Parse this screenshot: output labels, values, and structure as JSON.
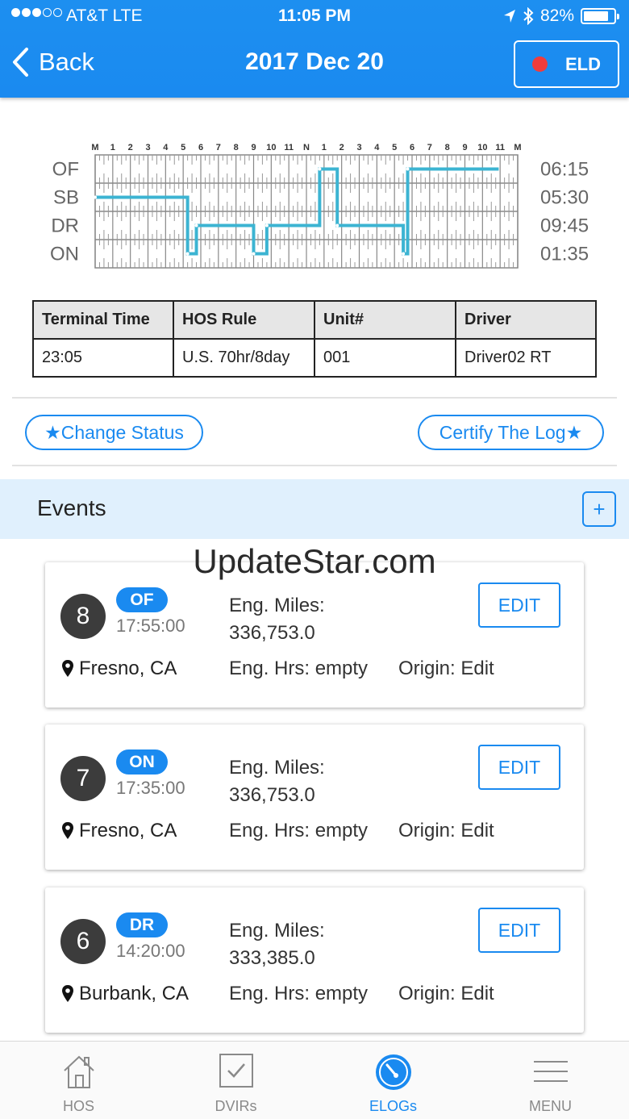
{
  "status_bar": {
    "carrier": "AT&T   LTE",
    "time": "11:05 PM",
    "battery": "82%",
    "battery_level": 0.82,
    "signal_bars_filled": 3,
    "signal_bars_total": 5
  },
  "nav": {
    "back_label": "Back",
    "title": "2017 Dec 20",
    "eld_label": "ELD"
  },
  "log_chart": {
    "hour_labels": [
      "M",
      "1",
      "2",
      "3",
      "4",
      "5",
      "6",
      "7",
      "8",
      "9",
      "10",
      "11",
      "N",
      "1",
      "2",
      "3",
      "4",
      "5",
      "6",
      "7",
      "8",
      "9",
      "10",
      "11",
      "M"
    ],
    "statuses": [
      "OF",
      "SB",
      "DR",
      "ON"
    ],
    "totals": [
      "06:15",
      "05:30",
      "09:45",
      "01:35"
    ],
    "line_color": "#3cb4d2",
    "segments": [
      {
        "status": "SB",
        "start": 0.0,
        "end": 5.25
      },
      {
        "status": "ON",
        "start": 5.25,
        "end": 5.75
      },
      {
        "status": "DR",
        "start": 5.75,
        "end": 9.0
      },
      {
        "status": "ON",
        "start": 9.0,
        "end": 9.75
      },
      {
        "status": "DR",
        "start": 9.75,
        "end": 12.75
      },
      {
        "status": "OF",
        "start": 12.75,
        "end": 13.75
      },
      {
        "status": "DR",
        "start": 13.75,
        "end": 17.5
      },
      {
        "status": "ON",
        "start": 17.5,
        "end": 17.75
      },
      {
        "status": "OF",
        "start": 17.75,
        "end": 22.92
      }
    ]
  },
  "info_table": {
    "headers": [
      "Terminal Time",
      "HOS Rule",
      "Unit#",
      "Driver"
    ],
    "values": [
      "23:05",
      "U.S. 70hr/8day",
      "001",
      "Driver02 RT"
    ]
  },
  "actions": {
    "change_status": "★Change Status",
    "certify_log": "Certify The Log★"
  },
  "events": {
    "title": "Events",
    "add_label": "+",
    "items": [
      {
        "number": "8",
        "status": "OF",
        "time": "17:55:00",
        "location": "Fresno, CA",
        "miles_label": "Eng. Miles:",
        "miles": "336,753.0",
        "hours": "Eng. Hrs: empty",
        "origin": "Origin: Edit",
        "edit_label": "EDIT"
      },
      {
        "number": "7",
        "status": "ON",
        "time": "17:35:00",
        "location": "Fresno, CA",
        "miles_label": "Eng. Miles:",
        "miles": "336,753.0",
        "hours": "Eng. Hrs: empty",
        "origin": "Origin: Edit",
        "edit_label": "EDIT"
      },
      {
        "number": "6",
        "status": "DR",
        "time": "14:20:00",
        "location": "Burbank, CA",
        "miles_label": "Eng. Miles:",
        "miles": "333,385.0",
        "hours": "Eng. Hrs: empty",
        "origin": "Origin: Edit",
        "edit_label": "EDIT"
      }
    ]
  },
  "watermark": "UpdateStar.com",
  "tabs": [
    {
      "label": "HOS",
      "icon": "house-icon",
      "active": false
    },
    {
      "label": "DVIRs",
      "icon": "checkbox-icon",
      "active": false
    },
    {
      "label": "ELOGs",
      "icon": "gauge-icon",
      "active": true
    },
    {
      "label": "MENU",
      "icon": "menu-icon",
      "active": false
    }
  ],
  "colors": {
    "accent": "#1a8af0",
    "events_bar": "#e0f0fd",
    "eld_dot": "#f03c3c"
  }
}
